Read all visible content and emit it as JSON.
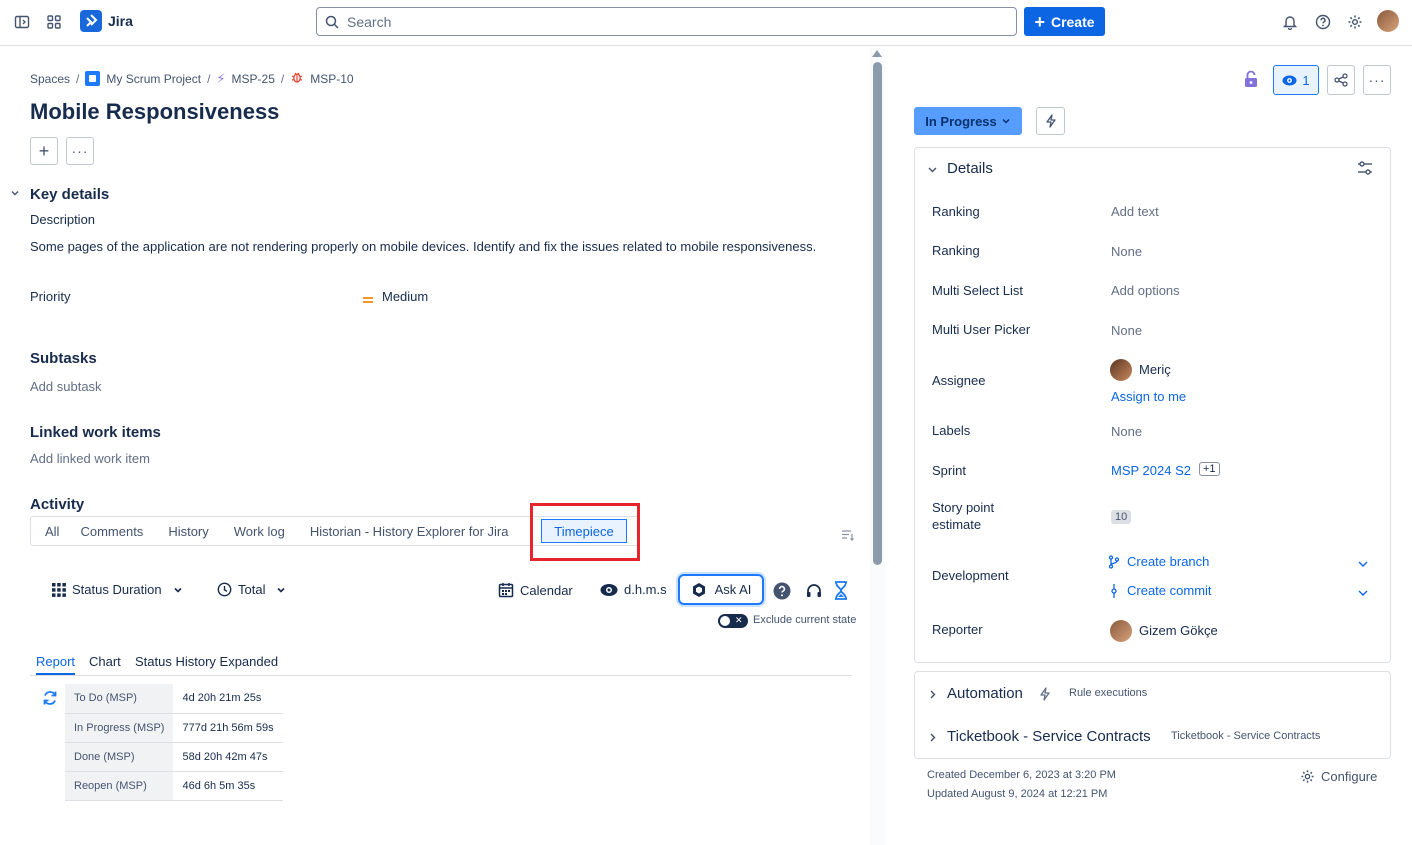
{
  "topnav": {
    "app_name": "Jira",
    "search_placeholder": "Search",
    "create_label": "Create"
  },
  "breadcrumb": {
    "items": [
      "Spaces",
      "My Scrum Project",
      "MSP-25",
      "MSP-10"
    ],
    "separator": "/"
  },
  "issue": {
    "title": "Mobile Responsiveness",
    "key_details_heading": "Key details",
    "description_label": "Description",
    "description": "Some pages of the application are not rendering properly on mobile devices. Identify and fix the issues related to mobile responsiveness.",
    "priority_label": "Priority",
    "priority_value": "Medium",
    "subtasks_heading": "Subtasks",
    "add_subtask": "Add subtask",
    "linked_heading": "Linked work items",
    "add_linked": "Add linked work item"
  },
  "activity": {
    "heading": "Activity",
    "tabs": [
      "All",
      "Comments",
      "History",
      "Work log",
      "Historian - History Explorer for Jira",
      "Timepiece"
    ],
    "active_tab": "Timepiece"
  },
  "timepiece": {
    "status_duration": "Status Duration",
    "total": "Total",
    "calendar": "Calendar",
    "format": "d.h.m.s",
    "ask_ai": "Ask AI",
    "exclude_current": "Exclude current state",
    "subtabs": [
      "Report",
      "Chart",
      "Status History Expanded"
    ],
    "active_subtab": "Report",
    "rows": [
      {
        "status": "To Do (MSP)",
        "duration": "4d 20h 21m 25s"
      },
      {
        "status": "In Progress (MSP)",
        "duration": "777d 21h 56m 59s"
      },
      {
        "status": "Done (MSP)",
        "duration": "58d 20h 42m 47s"
      },
      {
        "status": "Reopen (MSP)",
        "duration": "46d 6h 5m 35s"
      }
    ]
  },
  "sidebar": {
    "watch_count": "1",
    "status": "In Progress",
    "details_heading": "Details",
    "fields": {
      "ranking1_label": "Ranking",
      "ranking1_value": "Add text",
      "ranking2_label": "Ranking",
      "ranking2_value": "None",
      "msl_label": "Multi Select List",
      "msl_value": "Add options",
      "mup_label": "Multi User Picker",
      "mup_value": "None",
      "assignee_label": "Assignee",
      "assignee_value": "Meriç",
      "assign_to_me": "Assign to me",
      "labels_label": "Labels",
      "labels_value": "None",
      "sprint_label": "Sprint",
      "sprint_value": "MSP 2024 S2",
      "sprint_extra": "+1",
      "spe_label_1": "Story point",
      "spe_label_2": "estimate",
      "spe_value": "10",
      "development_label": "Development",
      "create_branch": "Create branch",
      "create_commit": "Create commit",
      "reporter_label": "Reporter",
      "reporter_value": "Gizem Gökçe"
    },
    "automation_heading": "Automation",
    "rule_executions": "Rule executions",
    "ticketbook_heading": "Ticketbook - Service Contracts",
    "ticketbook_sub": "Ticketbook - Service Contracts",
    "created": "Created December 6, 2023 at 3:20 PM",
    "updated": "Updated August 9, 2024 at 12:21 PM",
    "configure": "Configure"
  },
  "colors": {
    "brand_blue": "#0c66e4",
    "status_blue": "#579dff",
    "highlight_red": "#e5252a",
    "priority_orange": "#f18d13"
  }
}
